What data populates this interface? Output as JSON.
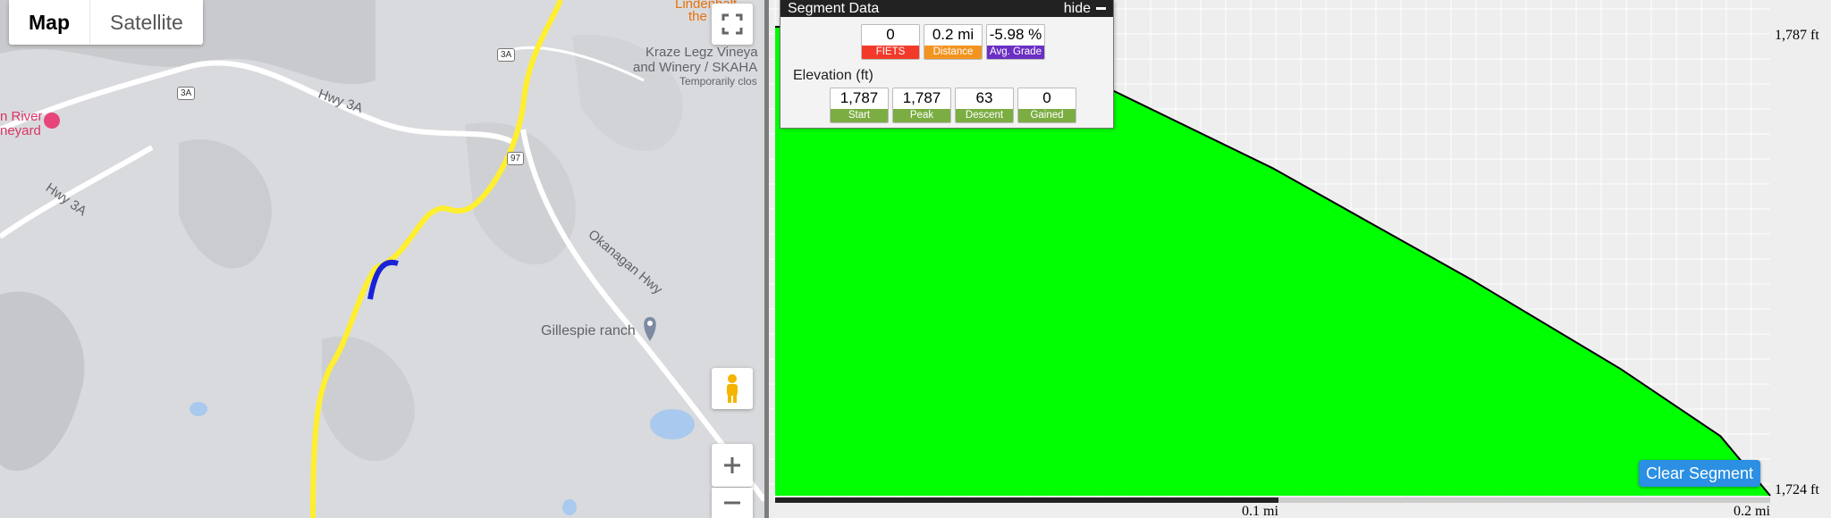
{
  "map": {
    "type_buttons": [
      {
        "label": "Map"
      },
      {
        "label": "Satellite"
      }
    ],
    "labels": {
      "winery_kraze_1": "Kraze Legz Vineya",
      "winery_kraze_2": "and Winery / SKAHA",
      "winery_kraze_3": "Temporarily clos",
      "lindenhalt_1": "Lindenhalt",
      "lindenhalt_2": "the",
      "river_1": "n River",
      "river_2": "neyard",
      "hwy3a_1": "Hwy 3A",
      "hwy3a_2": "Hwy 3A",
      "okanagan_hwy": "Okanagan Hwy",
      "gillespie": "Gillespie ranch"
    },
    "shields": {
      "s1": "3A",
      "s2": "3A",
      "s3": "97"
    }
  },
  "segment": {
    "header": "Segment Data",
    "hide_label": "hide",
    "stats": [
      {
        "value": "0",
        "label": "FIETS",
        "color": "#f23a2a"
      },
      {
        "value": "0.2 mi",
        "label": "Distance",
        "color": "#f39420"
      },
      {
        "value": "-5.98 %",
        "label": "Avg. Grade",
        "color": "#6b2fc4"
      }
    ],
    "elevation_title": "Elevation (ft)",
    "elevation": [
      {
        "value": "1,787",
        "label": "Start"
      },
      {
        "value": "1,787",
        "label": "Peak"
      },
      {
        "value": "63",
        "label": "Descent"
      },
      {
        "value": "0",
        "label": "Gained"
      }
    ],
    "elevation_label_color": "#7cad43"
  },
  "chart": {
    "y_top_label": "1,787 ft",
    "y_bottom_label": "1,724 ft",
    "x_mid_label": "0.1 mi",
    "x_end_label": "0.2 mi",
    "fill_color": "#00ff00",
    "line_color": "#000000",
    "profile": [
      [
        0.0,
        1787
      ],
      [
        0.15,
        1787
      ],
      [
        0.3,
        1781
      ],
      [
        0.5,
        1768
      ],
      [
        0.7,
        1753
      ],
      [
        0.85,
        1741
      ],
      [
        0.95,
        1732
      ],
      [
        1.0,
        1724
      ]
    ]
  },
  "clear_button": "Clear Segment"
}
